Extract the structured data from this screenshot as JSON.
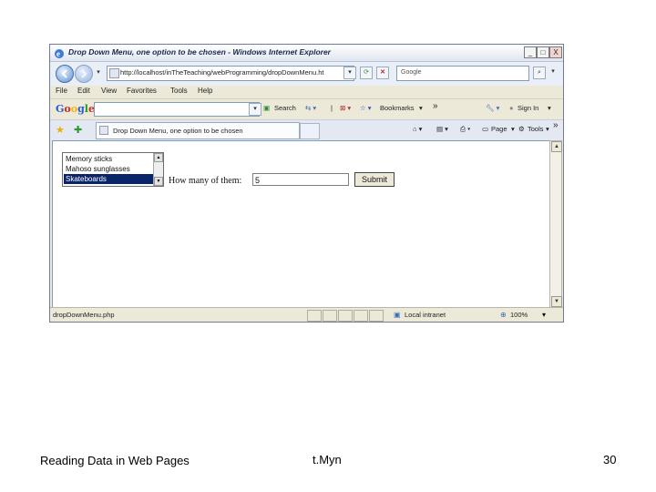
{
  "window": {
    "title": "Drop Down Menu, one option to be chosen - Windows Internet Explorer",
    "minimize": "_",
    "maximize": "□",
    "close": "X"
  },
  "address_bar": {
    "url": "http://localhost/inTheTeaching/webProgramming/dropDownMenu.ht",
    "search_placeholder": "Google"
  },
  "menu": [
    "File",
    "Edit",
    "View",
    "Favorites",
    "Tools",
    "Help"
  ],
  "google_toolbar": {
    "logo": "Google",
    "search_label": "Search",
    "bookmarks_label": "Bookmarks",
    "more": "»",
    "sign_in": "Sign In"
  },
  "tabs": {
    "active_tab": "Drop Down Menu, one option to be chosen",
    "page_label": "Page",
    "tools_label": "Tools",
    "more": "»"
  },
  "page": {
    "listbox_options": [
      "Memory sticks",
      "Mahoso sunglasses",
      "Skateboards"
    ],
    "selected_index": 2,
    "quantity_label": "How many of them:",
    "quantity_value": "5",
    "submit_label": "Submit"
  },
  "status_bar": {
    "text": "dropDownMenu.php",
    "zone": "Local intranet",
    "zoom": "100%"
  },
  "slide_footer": {
    "left": "Reading Data in Web Pages",
    "center": "t.Myn",
    "page_number": "30"
  }
}
